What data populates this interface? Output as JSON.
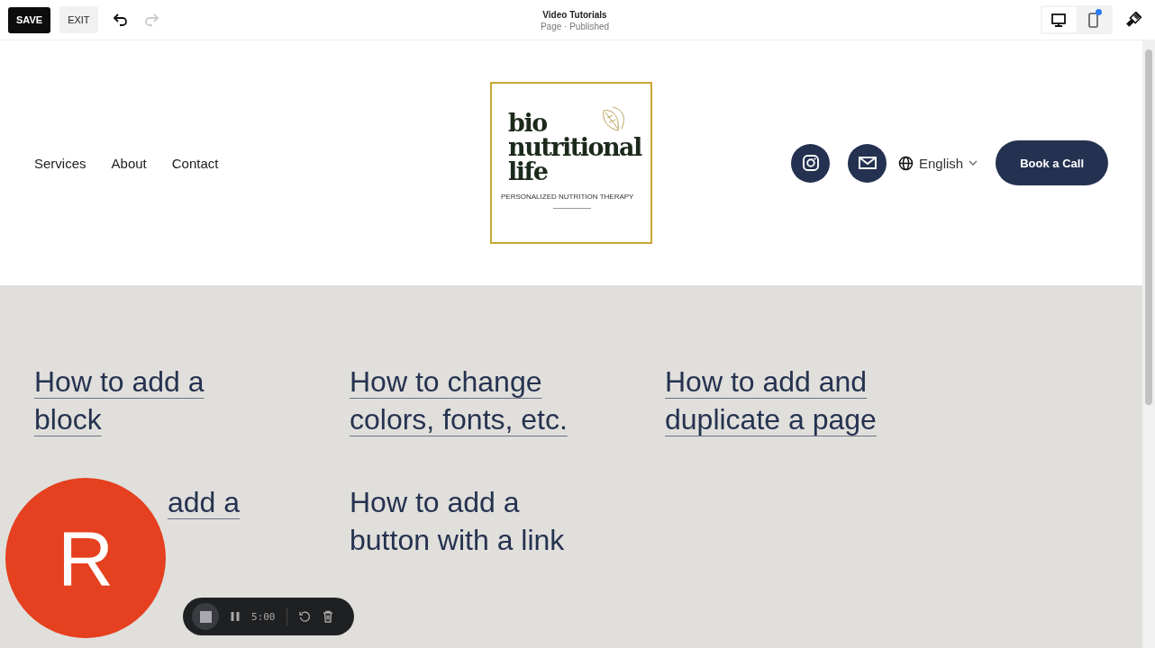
{
  "toolbar": {
    "save": "SAVE",
    "exit": "EXIT",
    "undo": {
      "disabled": false
    },
    "redo": {
      "disabled": true
    },
    "title": "Video Tutorials",
    "subtitle": "Page · Published",
    "devices": [
      {
        "kind": "desktop",
        "selected": true
      },
      {
        "kind": "mobile",
        "selected": false,
        "notification": true
      }
    ]
  },
  "header": {
    "nav": [
      "Services",
      "About",
      "Contact"
    ],
    "logo": {
      "lines": [
        "bio",
        "nutritional",
        "life"
      ],
      "tagline": "PERSONALIZED NUTRITION THERAPY"
    },
    "social": [
      {
        "kind": "instagram"
      },
      {
        "kind": "email"
      }
    ],
    "language": "English",
    "cta": "Book a Call"
  },
  "tutorials": [
    {
      "text": "How to add a\nblock",
      "kind": "full"
    },
    {
      "text": "How to change\ncolors, fonts, etc.",
      "kind": "full"
    },
    {
      "text": "How to add and\nduplicate a page",
      "kind": "full"
    },
    {
      "text": "add a",
      "kind": "covered"
    },
    {
      "text": "How to add a\nbutton with a link",
      "kind": "plain"
    }
  ],
  "recorder": {
    "avatar": "R",
    "time": "5:00"
  }
}
